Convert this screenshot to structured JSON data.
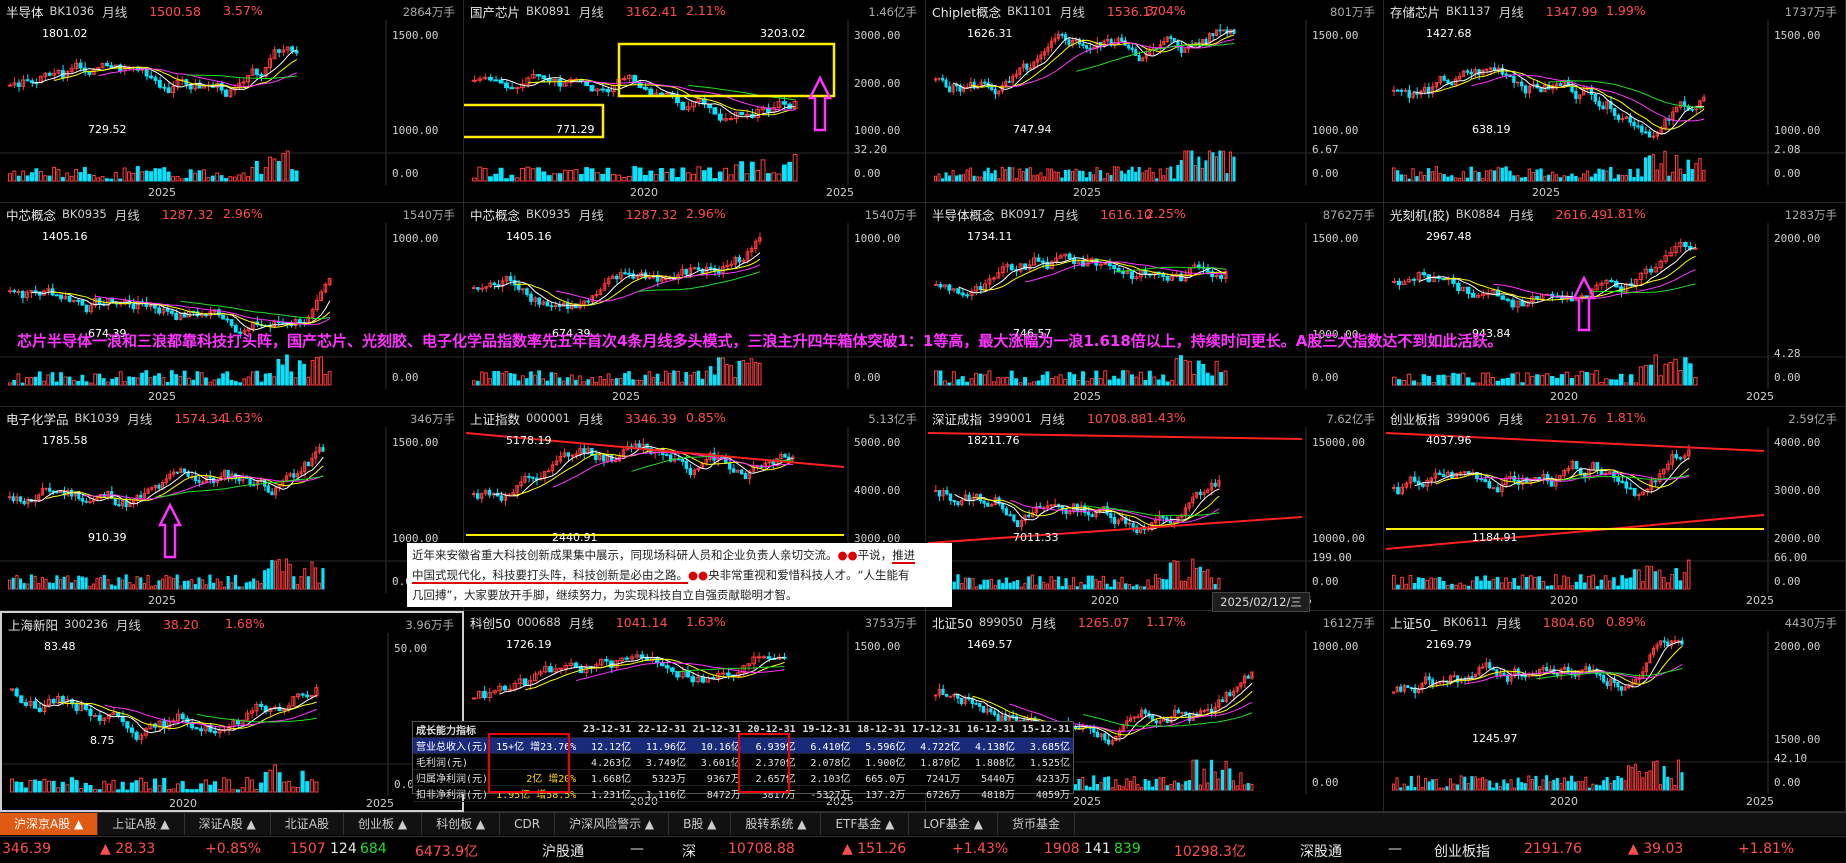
{
  "panels": [
    {
      "name": "半导体",
      "code": "BK1036",
      "period": "月线",
      "price": "1500.58",
      "pct": "3.57%",
      "vol": "2864万手",
      "y": [
        "1500.00",
        "1000.00"
      ],
      "vy": [
        "0.00"
      ],
      "x": [
        "2025"
      ],
      "hi": "1801.02",
      "lo": "729.52"
    },
    {
      "name": "国产芯片",
      "code": "BK0891",
      "period": "月线",
      "price": "3162.41",
      "pct": "2.11%",
      "vol": "1.46亿手",
      "y": [
        "3000.00",
        "2000.00",
        "1000.00"
      ],
      "vy": [
        "32.20",
        "0.00"
      ],
      "x": [
        "2020",
        "2025"
      ],
      "hi": "3203.02",
      "lo": "771.29"
    },
    {
      "name": "Chiplet概念",
      "code": "BK1101",
      "period": "月线",
      "price": "1536.17",
      "pct": "3.04%",
      "vol": "801万手",
      "y": [
        "1500.00",
        "1000.00"
      ],
      "vy": [
        "6.67",
        "0.00"
      ],
      "x": [
        "2025"
      ],
      "hi": "1626.31",
      "lo": "747.94"
    },
    {
      "name": "存储芯片",
      "code": "BK1137",
      "period": "月线",
      "price": "1347.99",
      "pct": "1.99%",
      "vol": "1737万手",
      "y": [
        "1500.00",
        "1000.00"
      ],
      "vy": [
        "2.08",
        "0.00"
      ],
      "x": [
        "2025"
      ],
      "hi": "1427.68",
      "lo": "638.19"
    },
    {
      "name": "中芯概念",
      "code": "BK0935",
      "period": "月线",
      "price": "1287.32",
      "pct": "2.96%",
      "vol": "1540万手",
      "y": [
        "1000.00"
      ],
      "vy": [
        "0.00"
      ],
      "x": [
        "2025"
      ],
      "hi": "1405.16",
      "lo": "674.39"
    },
    {
      "name": "中芯概念",
      "code": "BK0935",
      "period": "月线",
      "price": "1287.32",
      "pct": "2.96%",
      "vol": "1540万手",
      "y": [
        "1000.00"
      ],
      "vy": [
        "0.00"
      ],
      "x": [
        "2025"
      ],
      "hi": "1405.16",
      "lo": "674.39"
    },
    {
      "name": "半导体概念",
      "code": "BK0917",
      "period": "月线",
      "price": "1616.10",
      "pct": "2.25%",
      "vol": "8762万手",
      "y": [
        "1500.00",
        "1000.00"
      ],
      "vy": [
        "0.00"
      ],
      "x": [
        "2025"
      ],
      "hi": "1734.11",
      "lo": "746.57"
    },
    {
      "name": "光刻机(胶)",
      "code": "BK0884",
      "period": "月线",
      "price": "2616.49",
      "pct": "1.81%",
      "vol": "1283万手",
      "y": [
        "2000.00"
      ],
      "vy": [
        "4.28",
        "0.00"
      ],
      "x": [
        "2020",
        "2025"
      ],
      "hi": "2967.48",
      "lo": "943.84"
    },
    {
      "name": "电子化学品",
      "code": "BK1039",
      "period": "月线",
      "price": "1574.34",
      "pct": "1.63%",
      "vol": "346万手",
      "y": [
        "1500.00",
        "1000.00"
      ],
      "vy": [
        "0.00"
      ],
      "x": [
        "2025"
      ],
      "hi": "1785.58",
      "lo": "910.39"
    },
    {
      "name": "上证指数",
      "code": "000001",
      "period": "月线",
      "price": "3346.39",
      "pct": "0.85%",
      "vol": "5.13亿手",
      "y": [
        "5000.00",
        "4000.00",
        "3000.00"
      ],
      "vy": [
        "23.40",
        "0.00"
      ],
      "x": [],
      "hi": "5178.19",
      "lo": "2440.91"
    },
    {
      "name": "深证成指",
      "code": "399001",
      "period": "月线",
      "price": "10708.88",
      "pct": "1.43%",
      "vol": "7.62亿手",
      "y": [
        "15000.00",
        "10000.00"
      ],
      "vy": [
        "199.00",
        "0.00"
      ],
      "x": [
        "2020",
        "2025"
      ],
      "hi": "18211.76",
      "lo": "7011.33"
    },
    {
      "name": "创业板指",
      "code": "399006",
      "period": "月线",
      "price": "2191.76",
      "pct": "1.81%",
      "vol": "2.59亿手",
      "y": [
        "4000.00",
        "3000.00",
        "2000.00"
      ],
      "vy": [
        "66.00",
        "0.00"
      ],
      "x": [
        "2020",
        "2025"
      ],
      "hi": "4037.96",
      "lo": "1184.91"
    },
    {
      "name": "上海新阳",
      "code": "300236",
      "period": "月线",
      "price": "38.20",
      "pct": "1.68%",
      "vol": "3.96万手",
      "y": [
        "50.00"
      ],
      "vy": [
        "0.00"
      ],
      "x": [
        "2020",
        "2025"
      ],
      "hi": "83.48",
      "lo": "8.75"
    },
    {
      "name": "科创50",
      "code": "000688",
      "period": "月线",
      "price": "1041.14",
      "pct": "1.63%",
      "vol": "3753万手",
      "y": [
        "1500.00"
      ],
      "vy": [
        "0.00"
      ],
      "x": [
        "2020",
        "2025"
      ],
      "hi": "1726.19",
      "lo": ""
    },
    {
      "name": "北证50",
      "code": "899050",
      "period": "月线",
      "price": "1265.07",
      "pct": "1.17%",
      "vol": "1612万手",
      "y": [
        "1000.00"
      ],
      "vy": [
        "0.00"
      ],
      "x": [
        "2025"
      ],
      "hi": "1469.57",
      "lo": "92"
    },
    {
      "name": "上证50_",
      "code": "BK0611",
      "period": "月线",
      "price": "1804.60",
      "pct": "0.89%",
      "vol": "4430万手",
      "y": [
        "2000.00",
        "1500.00"
      ],
      "vy": [
        "42.10",
        "0.00"
      ],
      "x": [
        "2020",
        "2025"
      ],
      "hi": "2169.79",
      "lo": "1245.97"
    }
  ],
  "banner": "芯片半导体一浪和三浪都靠科技打头阵，国产芯片、光刻胶、电子化学品指数率先五年首次4条月线多头模式，三浪主升四年箱体突破1：1等高，最大涨幅为一浪1.618倍以上，持续时间更长。A股三大指数达不到如此活跃。",
  "news": {
    "l1a": "近年来安徽省重大科技创新成果集中展示，同现场科研人员和企业负责人亲切交流。",
    "l1b": "平说，",
    "l1c": "推进",
    "l2a": "中国式现代化，科技要打头阵，科技创新是必由之路。",
    "l2b": "央非常重视和爱惜科技人才。“人生能有",
    "l3": "几回搏”，大家要放开手脚，继续努力，为实现科技自立自强贡献聪明才智。"
  },
  "datestamp": "2025/02/12/三",
  "fin": {
    "title": "成长能力指标",
    "cols": [
      "23-12-31",
      "22-12-31",
      "21-12-31",
      "20-12-31",
      "19-12-31",
      "18-12-31",
      "17-12-31",
      "16-12-31",
      "15-12-31"
    ],
    "rows": [
      {
        "label": "营业总收入(元)",
        "note": "15+亿  增23.76%",
        "vals": [
          "12.12亿",
          "11.96亿",
          "10.16亿",
          "6.939亿",
          "6.410亿",
          "5.596亿",
          "4.722亿",
          "4.138亿",
          "3.685亿"
        ]
      },
      {
        "label": "毛利润(元)",
        "note": "",
        "vals": [
          "4.263亿",
          "3.749亿",
          "3.601亿",
          "2.370亿",
          "2.078亿",
          "1.900亿",
          "1.870亿",
          "1.808亿",
          "1.525亿"
        ]
      },
      {
        "label": "归属净利润(元)",
        "note": "2亿    增20%",
        "vals": [
          "1.668亿",
          "5323万",
          "9367万",
          "2.657亿",
          "2.103亿",
          "665.0万",
          "7241万",
          "5440万",
          "4233万"
        ]
      },
      {
        "label": "扣非净利润(元)",
        "note": "1.95亿  增58.5%",
        "vals": [
          "1.231亿",
          "1.116亿",
          "8472万",
          "3817万",
          "-5327万",
          "137.2万",
          "6726万",
          "4818万",
          "4059万"
        ]
      }
    ]
  },
  "tabs": [
    "沪深京A股 ▲",
    "上证A股 ▲",
    "深证A股 ▲",
    "北证A股",
    "创业板 ▲",
    "科创板 ▲",
    "CDR",
    "沪深风险警示 ▲",
    "B股 ▲",
    "股转系统 ▲",
    "ETF基金 ▲",
    "LOF基金 ▲",
    "货币基金"
  ],
  "ticker": {
    "sh_price": "346.39",
    "sh_chg": "▲ 28.33",
    "sh_pct": "+0.85%",
    "sh_up": "1507",
    "sh_flat": "124",
    "sh_down": "684",
    "sh_amt": "6473.9亿",
    "hgt": "沪股通",
    "hgt_v": "—",
    "sz_lbl": "深",
    "sz_price": "10708.88",
    "sz_chg": "▲ 151.26",
    "sz_pct": "+1.43%",
    "sz_up": "1908",
    "sz_flat": "141",
    "sz_down": "839",
    "sz_amt": "10298.3亿",
    "sgt": "深股通",
    "sgt_v": "—",
    "cyb": "创业板指",
    "cyb_price": "2191.76",
    "cyb_chg": "▲ 39.03",
    "cyb_pct": "+1.81%"
  },
  "colors": {
    "up": "#ff3b3b",
    "down": "#00e5ff",
    "ma5": "#ffffff",
    "ma10": "#ffff00",
    "ma20": "#ff33ff",
    "ma60": "#22dd22",
    "accent": "#e05a14"
  }
}
